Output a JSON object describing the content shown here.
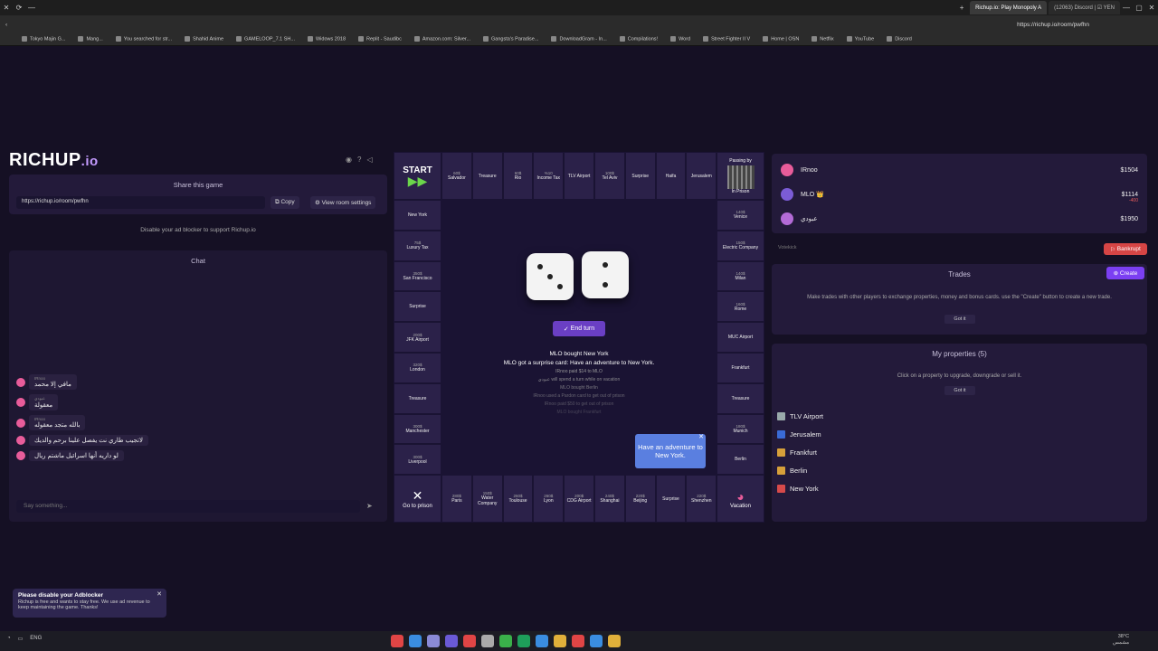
{
  "browser": {
    "tabs": [
      {
        "label": "Richup.io: Play Monopoly A"
      },
      {
        "label": "(12063) Discord | ☑ YEN"
      }
    ],
    "address": "https://richup.io/room/pwfhn",
    "bookmarks": [
      "Tokyo Majin G...",
      "Mang...",
      "You searched for str...",
      "Shahid Anime",
      "GAMELOOP_7.1 SH...",
      "Widows 2018",
      "Replit - Saudibc",
      "Amazon.com: Silver...",
      "Gangsta's Paradise...",
      "DownloadGram - In...",
      "Compilations!",
      "Word",
      "Street Fighter II V",
      "Home | OSN",
      "Netflix",
      "YouTube",
      "Discord"
    ]
  },
  "left": {
    "logo_main": "RICHUP",
    "logo_suffix": ".io",
    "share_title": "Share this game",
    "share_url": "https://richup.io/room/pwfhn",
    "copy_label": "Copy",
    "settings_label": "View room settings",
    "adblock_note": "Disable your ad blocker to support Richup.io",
    "chat_title": "Chat",
    "chat_placeholder": "Say something...",
    "chat_messages": [
      {
        "name": "IRnoo",
        "text": "مافي إلا محمد"
      },
      {
        "name": "عبودي",
        "text": "معقولة"
      },
      {
        "name": "IRnoo",
        "text": "بالله متجد معقوله"
      },
      {
        "name": "",
        "text": "لاتجيب طاري نت يفصل علينا برحم والديك"
      },
      {
        "name": "",
        "text": "لو داريه أنها اسرائيل ماشتم ريال"
      }
    ]
  },
  "ad_toast": {
    "title": "Please disable your Adblocker",
    "body": "Richup is free and wants to stay free. We use ad revenue to keep maintaining the game. Thanks!"
  },
  "board": {
    "start": "START",
    "go_to_prison": "Go to prison",
    "vacation": "Vacation",
    "passing_by": "Passing by",
    "in_prison": "In Prison",
    "top": [
      {
        "name": "Salvador",
        "price": "60$"
      },
      {
        "name": "Treasure",
        "price": ""
      },
      {
        "name": "Rio",
        "price": "60$"
      },
      {
        "name": "Income Tax",
        "price": "%10"
      },
      {
        "name": "TLV Airport",
        "price": ""
      },
      {
        "name": "Tel Aviv",
        "price": "100$"
      },
      {
        "name": "Surprise",
        "price": ""
      },
      {
        "name": "Haifa",
        "price": ""
      },
      {
        "name": "Jerusalem",
        "price": ""
      }
    ],
    "bottom": [
      {
        "name": "Paris",
        "price": "280$"
      },
      {
        "name": "Water Company",
        "price": "150$"
      },
      {
        "name": "Toulouse",
        "price": "260$"
      },
      {
        "name": "Lyon",
        "price": "260$"
      },
      {
        "name": "CDG Airport",
        "price": "200$"
      },
      {
        "name": "Shanghai",
        "price": "240$"
      },
      {
        "name": "Beijing",
        "price": "220$"
      },
      {
        "name": "Surprise",
        "price": ""
      },
      {
        "name": "Shenzhen",
        "price": "220$"
      }
    ],
    "left": [
      {
        "name": "New York",
        "price": ""
      },
      {
        "name": "Luxury Tax",
        "price": "75$"
      },
      {
        "name": "San Francisco",
        "price": "350$"
      },
      {
        "name": "Surprise",
        "price": ""
      },
      {
        "name": "JFK Airport",
        "price": "200$"
      },
      {
        "name": "London",
        "price": "320$"
      },
      {
        "name": "Treasure",
        "price": ""
      },
      {
        "name": "Manchester",
        "price": "300$"
      },
      {
        "name": "Liverpool",
        "price": "300$"
      }
    ],
    "right": [
      {
        "name": "Venice",
        "price": "140$"
      },
      {
        "name": "Electric Company",
        "price": "150$"
      },
      {
        "name": "Milan",
        "price": "140$"
      },
      {
        "name": "Rome",
        "price": "160$"
      },
      {
        "name": "MUC Airport",
        "price": ""
      },
      {
        "name": "Frankfurt",
        "price": ""
      },
      {
        "name": "Treasure",
        "price": ""
      },
      {
        "name": "Munich",
        "price": "180$"
      },
      {
        "name": "Berlin",
        "price": ""
      }
    ],
    "end_turn": "End turn",
    "log": [
      "MLO bought New York",
      "MLO got a surprise card: Have an adventure to New York.",
      "IRnoo paid $14 to MLO",
      "عبودي will spend a turn while on vacation",
      "MLO bought Berlin",
      "IRnoo used a Pardon card to get out of prison",
      "IRnoo paid $50 to get out of prison",
      "MLO bought Frankfurt"
    ],
    "popup": "Have an adventure to New York."
  },
  "right": {
    "players": [
      {
        "name": "IRnoo",
        "money": "$1504",
        "delta": "",
        "color": "#e85c9a"
      },
      {
        "name": "MLO 👑",
        "money": "$1114",
        "delta": "-400",
        "color": "#7b5cd6"
      },
      {
        "name": "عبودي",
        "money": "$1950",
        "delta": "",
        "color": "#b36bd6"
      }
    ],
    "votekick": "Votekick",
    "bankrupt": "Bankrupt",
    "trades_title": "Trades",
    "create": "Create",
    "trades_info": "Make trades with other players to exchange properties, money and bonus cards. use the \"Create\" button to create a new trade.",
    "got_it": "Got it",
    "properties_title": "My properties (5)",
    "properties_info": "Click on a property to upgrade, downgrade or sell it.",
    "properties": [
      {
        "name": "TLV Airport",
        "icon": "airplane-icon"
      },
      {
        "name": "Jerusalem",
        "icon": "israel-flag-icon"
      },
      {
        "name": "Frankfurt",
        "icon": "germany-flag-icon"
      },
      {
        "name": "Berlin",
        "icon": "germany-flag-icon"
      },
      {
        "name": "New York",
        "icon": "usa-flag-icon"
      }
    ]
  },
  "taskbar": {
    "lang": "ENG",
    "temp": "38°C",
    "weather": "مشمس"
  }
}
